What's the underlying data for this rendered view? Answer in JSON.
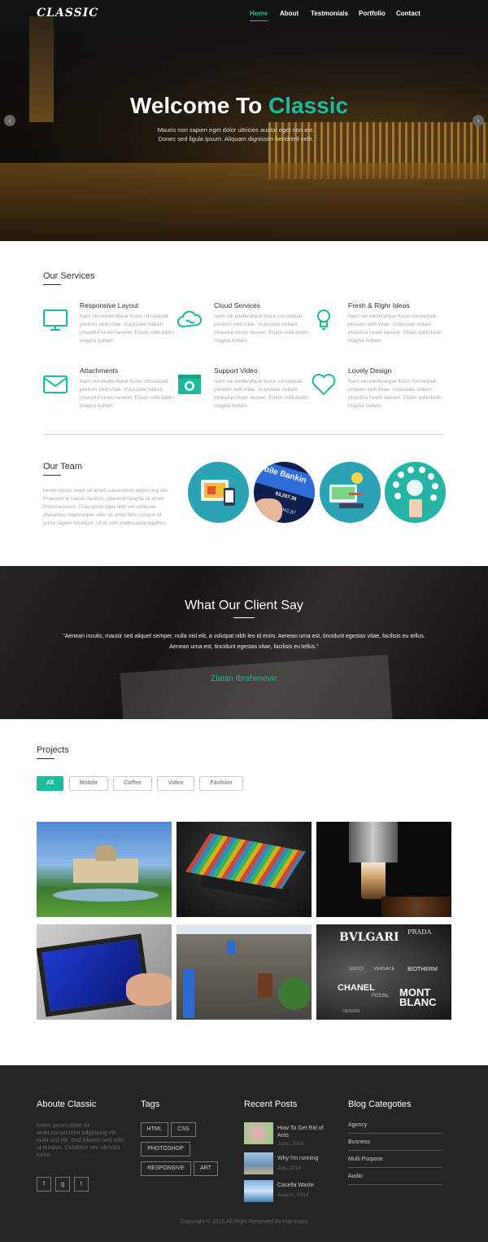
{
  "brand": "CLASSIC",
  "nav": [
    {
      "label": "Home",
      "active": true
    },
    {
      "label": "About"
    },
    {
      "label": "Testmonials"
    },
    {
      "label": "Portfolio"
    },
    {
      "label": "Contact"
    }
  ],
  "hero": {
    "title_prefix": "Welcome To ",
    "title_accent": "Classic",
    "subtitle": "Mauris non sapien eget dolor ultricies auctor eget non est. Donec sed ligula ipsum. Aliquam dignissim hendrerit velit."
  },
  "services": {
    "heading": "Our Services",
    "items": [
      {
        "title": "Responsive Layout",
        "icon": "monitor-icon",
        "text": "Nam vel eleifendque fusce consequat pretium velit vitae. Vulputate nullam pharetra lorem laoreet. Etiam sollicitudin magna nullam."
      },
      {
        "title": "Cloud Services",
        "icon": "cloud-icon",
        "text": "Nam vel eleifendque fusce consequat pretium velit vitae. Vulputate nullam pharetra lorem laoreet. Etiam sollicitudin magna nullam."
      },
      {
        "title": "Fresh & Righr Ideas",
        "icon": "lightbulb-icon",
        "text": "Nam vel eleifendque fusce consequat pretium velit vitae. Vulputate nullam pharetra lorem laoreet. Etiam sollicitudin magna nullam."
      },
      {
        "title": "Attachments",
        "icon": "envelope-icon",
        "text": "Nam vel eleifendque fusce consequat pretium velit vitae. Vulputate nullam pharetra lorem laoreet. Etiam sollicitudin magna nullam."
      },
      {
        "title": "Support Video",
        "icon": "camera-icon",
        "text": "Nam vel eleifendque fusce consequat pretium velit vitae. Vulputate nullam pharetra lorem laoreet. Etiam sollicitudin magna nullam."
      },
      {
        "title": "Lovely Design",
        "icon": "heart-icon",
        "text": "Nam vel eleifendque fusce consequat pretium velit vitae. Vulputate nullam pharetra lorem laoreet. Etiam sollicitudin magna nullam."
      }
    ]
  },
  "team": {
    "heading": "Our Team",
    "text": "lorem ipsum dolor sit amet consectetur adipiscing elit. Praesent a macus facilisis, placerat magna sit amet rhoncus lacus. Cras porta eget nibh vel vehicula phasellus ullamcorper odio sit amet felis congue id porta sapien tincidunt. Ut id sem malesuada dapibus.",
    "circle_1_text": "obile Bankin",
    "circle_2_text": "$3,207.36",
    "circle_3_text": "8942.87"
  },
  "testimonial": {
    "heading": "What Our Client Say",
    "quote": "\"Aenean inculis, mausir sed aliquet semper, nulla nisl elit, a volutpat nibh leo id enim. Aenean urna est, tincidunt egestas vitae, facilisis eu tellus. Aenean urna est, tincidunt egestas vitae, facilisis eu tellus.\"",
    "name": "Zlatan Ibrahimovic"
  },
  "projects": {
    "heading": "Projects",
    "filters": [
      {
        "label": "All",
        "active": true
      },
      {
        "label": "Mobile"
      },
      {
        "label": "Coffee"
      },
      {
        "label": "Video"
      },
      {
        "label": "Fashion"
      }
    ],
    "tile_5_labels": [
      "BVLGARI",
      "PRADA",
      "GUCCI",
      "VERSACE",
      "BIOTHERM",
      "CHANEL",
      "FOSSIL",
      "MONT BLANC",
      "DESIGN"
    ]
  },
  "footer": {
    "about": {
      "heading": "Aboute Classic",
      "text": "lorem ipsum dolar sit amet,consectetur adipiscing elit nulla nisl elit. Sed lobortis sed odio ut tempus. Curabitur nec ultricies tortor.",
      "social": [
        "f",
        "g",
        "t"
      ]
    },
    "tags": {
      "heading": "Tags",
      "items": [
        "HTML",
        "CSS",
        "PHOTOSHOP",
        "RESPONSIVE",
        "ART"
      ]
    },
    "recent": {
      "heading": "Recent Posts",
      "posts": [
        {
          "title": "How To Get Rid of Ants",
          "date": "June, 2014"
        },
        {
          "title": "Why I'm running",
          "date": "July, 2014"
        },
        {
          "title": "Casella Waste",
          "date": "August, 2014"
        }
      ]
    },
    "categories": {
      "heading": "Blog Categoties",
      "items": [
        "Agency",
        "Busness",
        "Multi Purpose",
        "Audio"
      ]
    },
    "copyright": "Copyright © 2015 All Right Reserved By Hammars"
  },
  "colors": {
    "accent": "#1abc9c",
    "footer_bg": "#252525"
  }
}
